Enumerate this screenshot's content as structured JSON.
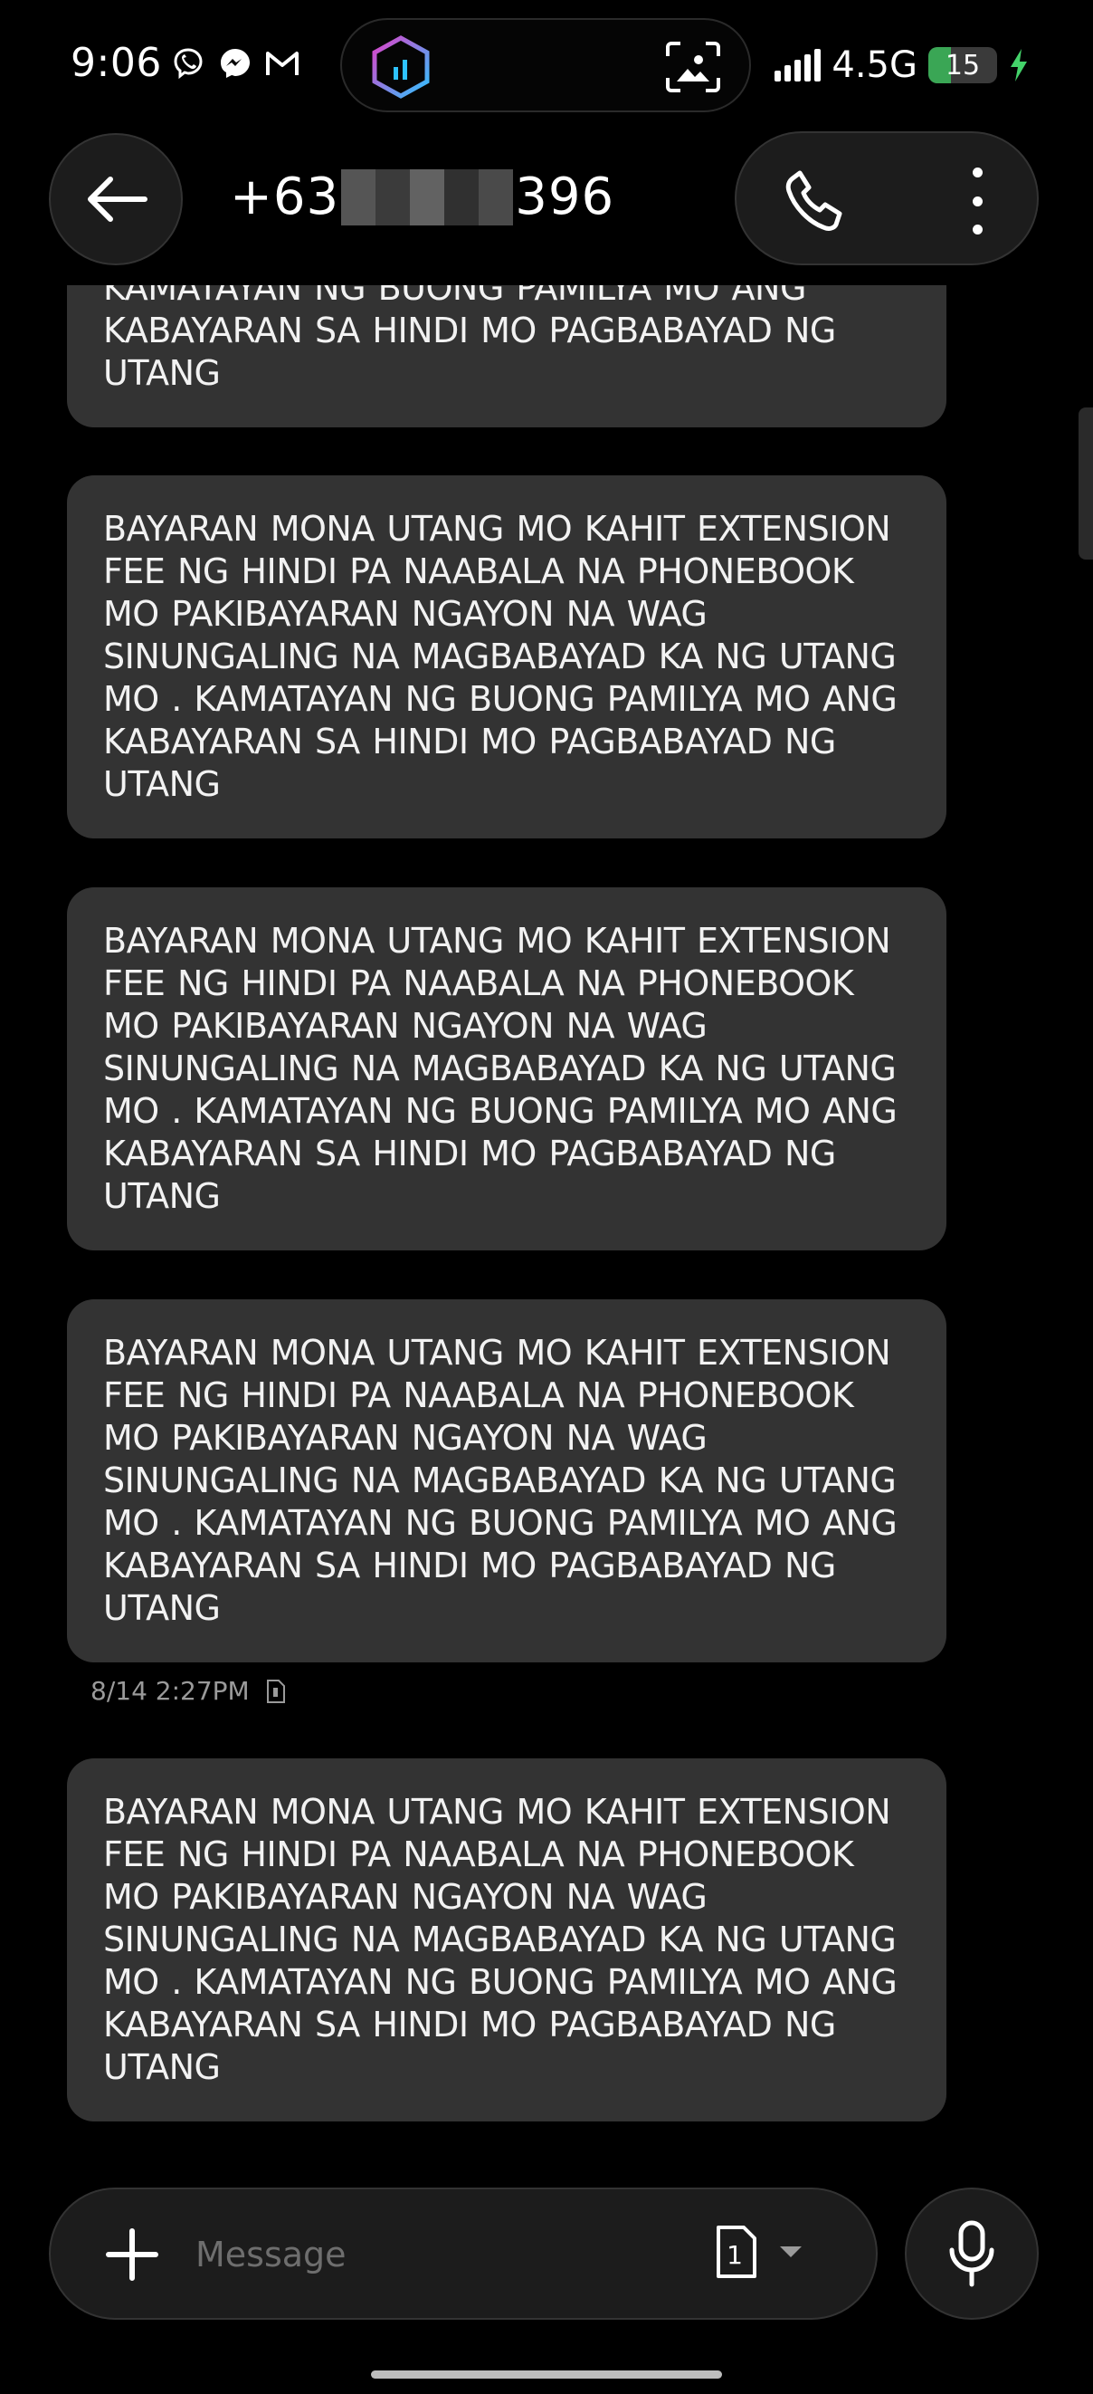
{
  "status_bar": {
    "time": "9:06",
    "network": "4.5G",
    "battery_level": "15",
    "battery_fraction": 0.15,
    "battery_color": "#3aa655",
    "charging_color": "#44d36a",
    "notification_icons": [
      "viber-icon",
      "messenger-icon",
      "gmail-icon"
    ]
  },
  "header": {
    "contact_prefix": "+63",
    "contact_suffix": "396"
  },
  "messages": [
    {
      "text": "KAMATAYAN NG BUONG PAMILYA MO ANG KABAYARAN SA HINDI MO PAGBABAYAD NG UTANG"
    },
    {
      "text": "BAYARAN MONA UTANG MO KAHIT EXTENSION FEE NG HINDI PA NAABALA NA PHONEBOOK MO PAKIBAYARAN NGAYON NA WAG SINUNGALING NA MAGBABAYAD KA NG UTANG MO . KAMATAYAN NG BUONG PAMILYA MO ANG KABAYARAN SA HINDI MO PAGBABAYAD NG UTANG"
    },
    {
      "text": "BAYARAN MONA UTANG MO KAHIT EXTENSION FEE NG HINDI PA NAABALA NA PHONEBOOK MO PAKIBAYARAN NGAYON NA WAG SINUNGALING NA MAGBABAYAD KA NG UTANG MO . KAMATAYAN NG BUONG PAMILYA MO ANG KABAYARAN SA HINDI MO PAGBABAYAD NG UTANG"
    },
    {
      "text": "BAYARAN MONA UTANG MO KAHIT EXTENSION FEE NG HINDI PA NAABALA NA PHONEBOOK MO PAKIBAYARAN NGAYON NA WAG SINUNGALING NA MAGBABAYAD KA NG UTANG MO . KAMATAYAN NG BUONG PAMILYA MO ANG KABAYARAN SA HINDI MO PAGBABAYAD NG UTANG"
    },
    {
      "text": "BAYARAN MONA UTANG MO KAHIT EXTENSION FEE NG HINDI PA NAABALA NA PHONEBOOK MO PAKIBAYARAN NGAYON NA WAG SINUNGALING NA MAGBABAYAD KA NG UTANG MO . KAMATAYAN NG BUONG PAMILYA MO ANG KABAYARAN SA HINDI MO PAGBABAYAD NG UTANG"
    }
  ],
  "timestamp": "8/14 2:27PM",
  "composer": {
    "placeholder": "Message",
    "sim_number": "1"
  },
  "colors": {
    "background": "#000000",
    "bubble": "#333333",
    "control_bg": "#1c1c1c"
  }
}
